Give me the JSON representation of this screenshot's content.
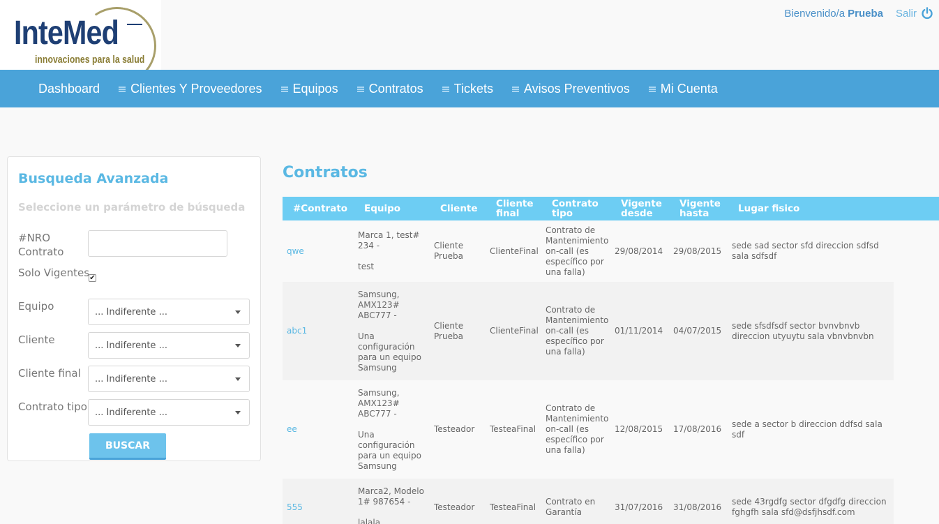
{
  "logo": {
    "name": "InteMed",
    "tagline": "innovaciones para la salud"
  },
  "user": {
    "welcome": "Bienvenido/a",
    "name": "Prueba",
    "logout": "Salir"
  },
  "nav": [
    {
      "label": "Dashboard",
      "icon": ""
    },
    {
      "label": "Clientes Y Proveedores",
      "icon": "menu-icon"
    },
    {
      "label": "Equipos",
      "icon": "menu-icon"
    },
    {
      "label": "Contratos",
      "icon": "menu-icon"
    },
    {
      "label": "Tickets",
      "icon": "menu-icon"
    },
    {
      "label": "Avisos Preventivos",
      "icon": "menu-icon"
    },
    {
      "label": "Mi Cuenta",
      "icon": "menu-icon"
    }
  ],
  "search": {
    "title": "Busqueda Avanzada",
    "hint": "Seleccione un parámetro de búsqueda",
    "nro_label": "#NRO Contrato",
    "nro_value": "",
    "vigentes_label": "Solo Vigentes",
    "vigentes_checked": true,
    "equipo_label": "Equipo",
    "equipo_value": "... Indiferente ...",
    "cliente_label": "Cliente",
    "cliente_value": "... Indiferente ...",
    "cliente_final_label": "Cliente final",
    "cliente_final_value": "... Indiferente ...",
    "contrato_tipo_label": "Contrato tipo",
    "contrato_tipo_value": "... Indiferente ...",
    "button": "BUSCAR"
  },
  "main": {
    "title": "Contratos",
    "columns": [
      "#Contrato",
      "Equipo",
      "Cliente",
      "Cliente final",
      "Contrato tipo",
      "Vigente desde",
      "Vigente hasta",
      "Lugar fisico"
    ],
    "rows": [
      {
        "id": "qwe",
        "equipo_name": "Marca 1, test# 234 -",
        "equipo_desc": "test",
        "cliente": "Cliente Prueba",
        "cliente_final": "ClienteFinal",
        "tipo": "Contrato de Mantenimiento on-call (es específico por una falla)",
        "desde": "29/08/2014",
        "hasta": "29/08/2015",
        "lugar": "sede sad sector sfd direccion sdfsd sala sdfsdf"
      },
      {
        "id": "abc1",
        "equipo_name": "Samsung, AMX123# ABC777 -",
        "equipo_desc": "Una configuración para un equipo Samsung",
        "cliente": "Cliente Prueba",
        "cliente_final": "ClienteFinal",
        "tipo": "Contrato de Mantenimiento on-call (es específico por una falla)",
        "desde": "01/11/2014",
        "hasta": "04/07/2015",
        "lugar": "sede sfsdfsdf sector bvnvbnvb direccion utyuytu sala vbnvbnvbn"
      },
      {
        "id": "ee",
        "equipo_name": "Samsung, AMX123# ABC777 -",
        "equipo_desc": "Una configuración para un equipo Samsung",
        "cliente": "Testeador",
        "cliente_final": "TesteaFinal",
        "tipo": "Contrato de Mantenimiento on-call (es específico por una falla)",
        "desde": "12/08/2015",
        "hasta": "17/08/2016",
        "lugar": "sede a sector b direccion ddfsd sala sdf"
      },
      {
        "id": "555",
        "equipo_name": "Marca2, Modelo 1# 987654 -",
        "equipo_desc": "lalala",
        "cliente": "Testeador",
        "cliente_final": "TesteaFinal",
        "tipo": "Contrato en Garantía",
        "desde": "31/07/2016",
        "hasta": "31/08/2016",
        "lugar": "sede 43rgdfg sector dfgdfg direccion fghgfh sala sfd@dsfjhsdf.com"
      }
    ]
  }
}
